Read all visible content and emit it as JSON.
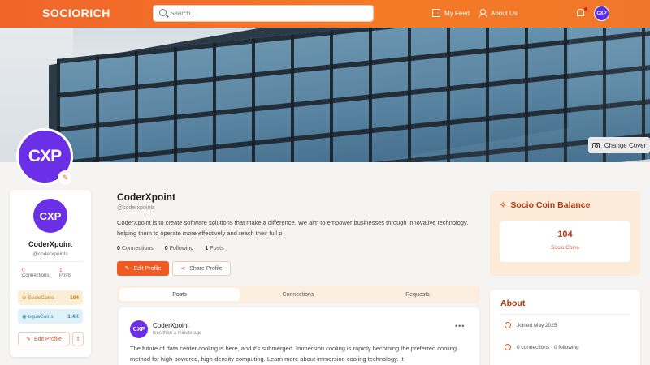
{
  "header": {
    "logo": "SOCIORICH",
    "search_placeholder": "Search...",
    "my_feed": "My Feed",
    "about_us": "About Us",
    "avatar_initials": "CXP"
  },
  "cover": {
    "change_cover": "Change Cover"
  },
  "profile": {
    "avatar_initials": "CXP",
    "name": "CoderXpoint",
    "handle": "@coderxpoints",
    "bio": "CoderXpoint is to create software solutions that make a difference. We aim to empower businesses through innovative technology, helping them to operate more effectively and reach their full p",
    "connections_count": "0",
    "connections_label": "Connections",
    "following_count": "0",
    "following_label": "Following",
    "posts_count": "1",
    "posts_label": "Posts",
    "edit_profile": "Edit Profile",
    "share_profile": "Share Profile"
  },
  "left_card": {
    "avatar_initials": "CXP",
    "name": "CoderXpoint",
    "handle": "@coderxpoints",
    "connections_count": "0",
    "connections_label": "Connections",
    "posts_count": "1",
    "posts_label": "Posts",
    "socio_label": "SocioCoins",
    "socio_value": "104",
    "equa_label": "equaCoins",
    "equa_value": "1.4K",
    "edit_profile": "Edit Profile"
  },
  "tabs": [
    {
      "label": "Posts"
    },
    {
      "label": "Connections"
    },
    {
      "label": "Requests"
    }
  ],
  "post": {
    "avatar_initials": "CXP",
    "author": "CoderXpoint",
    "time": "less than a minute ago",
    "more": "•••",
    "text": "The future of data center cooling is here, and it's submerged. Immersion cooling is rapidly becoming the preferred cooling method for high-powered, high-density computing. Learn more about immersion cooling technology. It"
  },
  "coin_balance": {
    "title": "Socio Coin Balance",
    "value": "104",
    "label": "Socio Coins"
  },
  "about": {
    "title": "About",
    "joined": "Joined May 2025",
    "connections": "0 connections · 0 following"
  },
  "colors": {
    "brand_orange": "#f0652a",
    "avatar_purple": "#6a2fe6"
  }
}
